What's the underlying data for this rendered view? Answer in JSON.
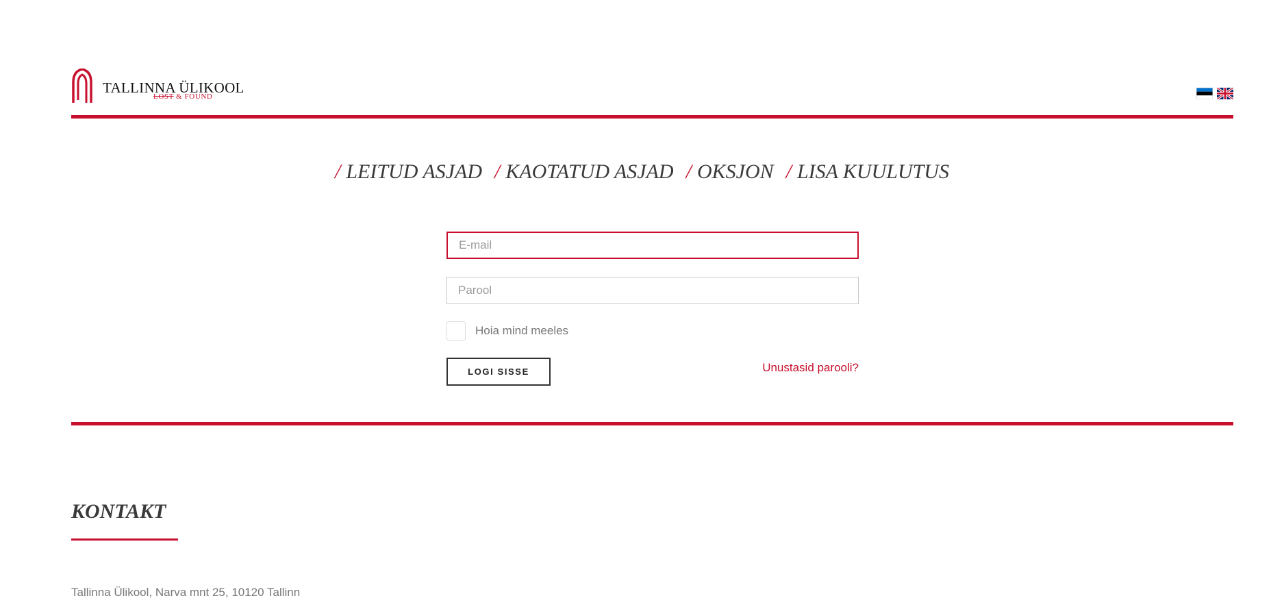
{
  "header": {
    "logo_title": "TALLINNA ÜLIKOOL",
    "logo_sub_strike": "LOST",
    "logo_sub_rest": " & FOUND",
    "languages": [
      "et",
      "en"
    ]
  },
  "nav": {
    "items": [
      {
        "label": "LEITUD ASJAD"
      },
      {
        "label": "KAOTATUD ASJAD"
      },
      {
        "label": "OKSJON"
      },
      {
        "label": "LISA KUULUTUS"
      }
    ],
    "separator": "/"
  },
  "form": {
    "email_placeholder": "E-mail",
    "email_value": "",
    "password_placeholder": "Parool",
    "password_value": "",
    "remember_label": "Hoia mind meeles",
    "remember_checked": false,
    "login_label": "LOGI SISSE",
    "forgot_label": "Unustasid parooli?"
  },
  "contact": {
    "title": "KONTAKT",
    "address": "Tallinna Ülikool, Narva mnt 25, 10120 Tallinn"
  },
  "colors": {
    "accent": "#c8102e",
    "text": "#3a3a3a",
    "muted": "#777777"
  },
  "icons": {
    "logo": "tallinn-university-arch-logo",
    "flag_et": "estonian-flag-icon",
    "flag_en": "uk-flag-icon"
  }
}
